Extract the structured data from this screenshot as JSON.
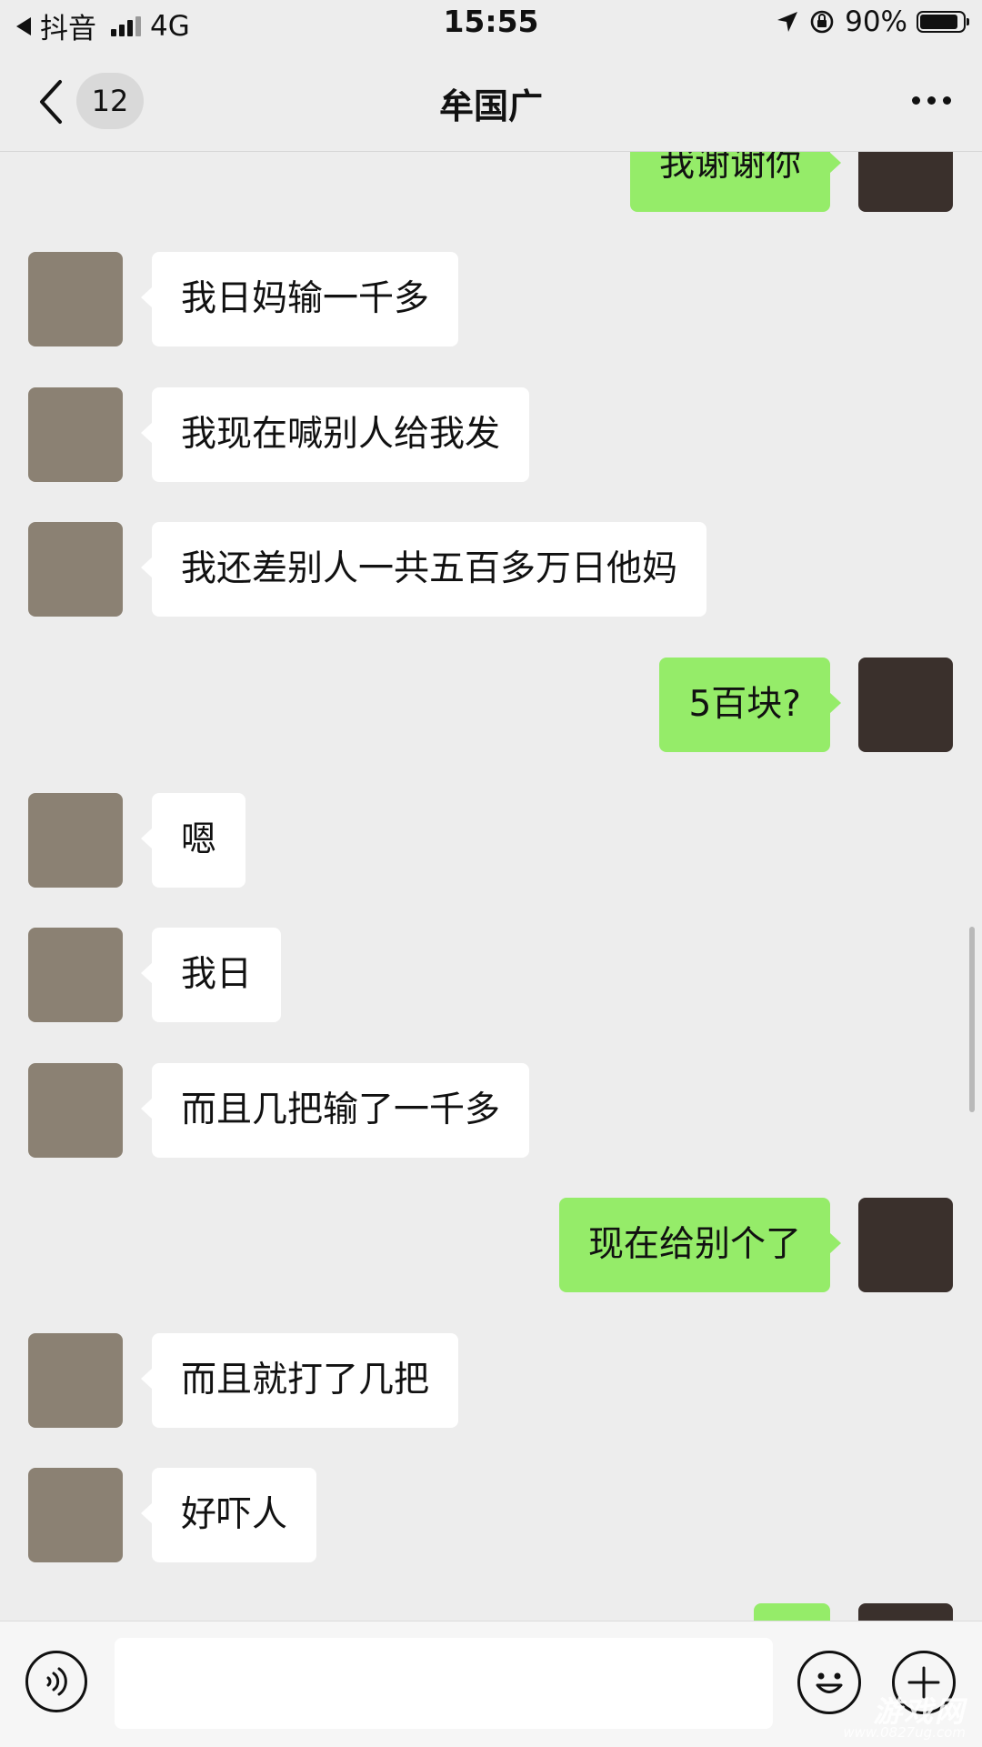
{
  "status_bar": {
    "back_app": "抖音",
    "network": "4G",
    "time": "15:55",
    "battery": "90%",
    "battery_level": 0.9
  },
  "nav": {
    "unread_count": "12",
    "title": "牟国广"
  },
  "messages": [
    {
      "side": "right",
      "text": "我谢谢你"
    },
    {
      "side": "left",
      "text": "我日妈输一千多"
    },
    {
      "side": "left",
      "text": "我现在喊别人给我发"
    },
    {
      "side": "left",
      "text": "我还差别人一共五百多万日他妈"
    },
    {
      "side": "right",
      "text": "5百块?"
    },
    {
      "side": "left",
      "text": "嗯"
    },
    {
      "side": "left",
      "text": "我日"
    },
    {
      "side": "left",
      "text": "而且几把输了一千多"
    },
    {
      "side": "right",
      "text": "现在给别个了"
    },
    {
      "side": "left",
      "text": "而且就打了几把"
    },
    {
      "side": "left",
      "text": "好吓人"
    },
    {
      "side": "right",
      "text": ""
    }
  ],
  "watermark": {
    "main": "游戏网",
    "url": "www.0827ug.com"
  },
  "colors": {
    "background": "#ededed",
    "sent_bubble": "#95ec69",
    "received_bubble": "#ffffff"
  },
  "icons": [
    "back-icon",
    "more-icon",
    "voice-icon",
    "emoji-icon",
    "add-icon",
    "location-arrow-icon",
    "rotation-lock-icon",
    "battery-icon",
    "signal-icon"
  ]
}
